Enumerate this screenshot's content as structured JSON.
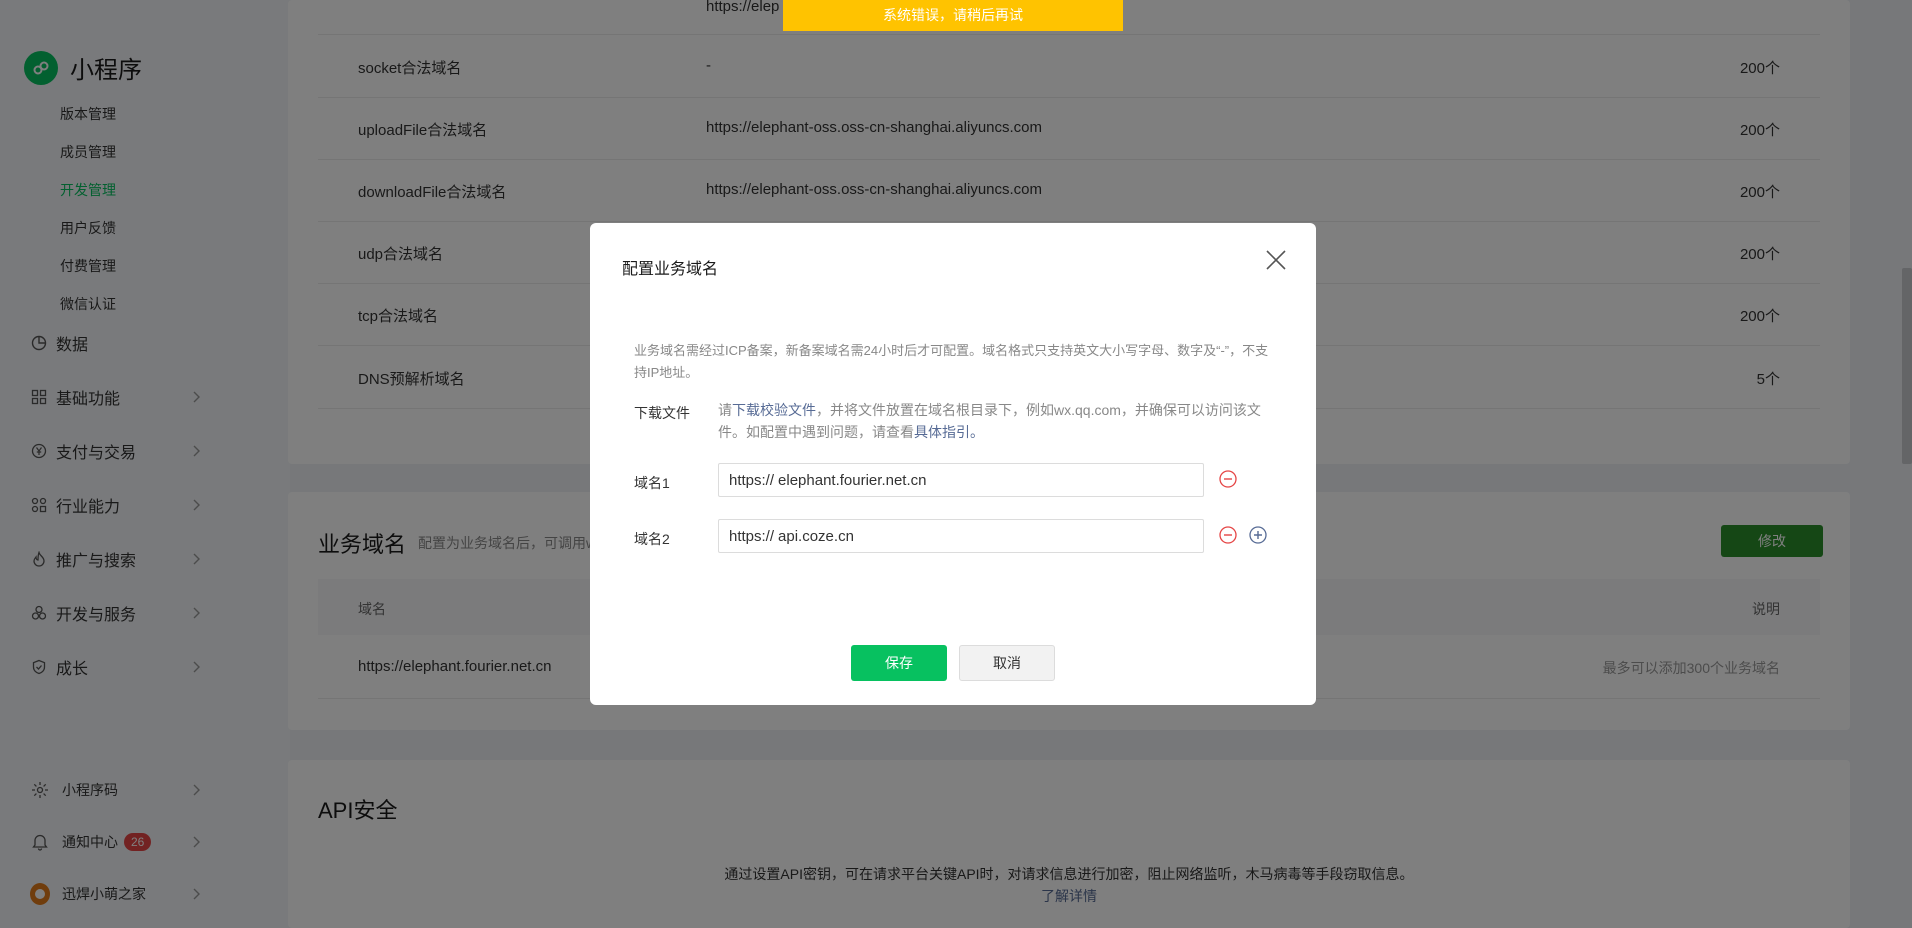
{
  "toast": "系统错误，请稍后再试",
  "sidebar": {
    "brand": "小程序",
    "sub_items": [
      "版本管理",
      "成员管理",
      "开发管理",
      "用户反馈",
      "付费管理",
      "微信认证"
    ],
    "active_sub_item": "开发管理",
    "nav_items": [
      {
        "label": "数据",
        "icon": "pie-chart-icon"
      },
      {
        "label": "基础功能",
        "icon": "grid-icon"
      },
      {
        "label": "支付与交易",
        "icon": "yen-icon"
      },
      {
        "label": "行业能力",
        "icon": "industry-icon"
      },
      {
        "label": "推广与搜索",
        "icon": "flame-icon"
      },
      {
        "label": "开发与服务",
        "icon": "dev-service-icon"
      },
      {
        "label": "成长",
        "icon": "shield-icon"
      }
    ],
    "bottom_items": [
      {
        "label": "小程序码",
        "icon": "qr-code-icon"
      },
      {
        "label": "通知中心",
        "icon": "bell-icon",
        "badge": "26"
      },
      {
        "label": "迅焊小萌之家",
        "icon": "avatar"
      }
    ]
  },
  "server_domains": {
    "top_partial_value": "https://elep",
    "rows": [
      {
        "name": "socket合法域名",
        "value": "-",
        "limit": "200个"
      },
      {
        "name": "uploadFile合法域名",
        "value": "https://elephant-oss.oss-cn-shanghai.aliyuncs.com",
        "limit": "200个"
      },
      {
        "name": "downloadFile合法域名",
        "value": "https://elephant-oss.oss-cn-shanghai.aliyuncs.com",
        "limit": "200个"
      },
      {
        "name": "udp合法域名",
        "value": "",
        "limit": "200个"
      },
      {
        "name": "tcp合法域名",
        "value": "",
        "limit": "200个"
      },
      {
        "name": "DNS预解析域名",
        "value": "",
        "limit": "5个"
      }
    ]
  },
  "business_domain": {
    "title": "业务域名",
    "desc": "配置为业务域名后，可调用w",
    "edit_label": "修改",
    "col_domain": "域名",
    "col_desc": "说明",
    "domain_value": "https://elephant.fourier.net.cn",
    "domain_note": "最多可以添加300个业务域名"
  },
  "api_security": {
    "title": "API安全",
    "desc": "通过设置API密钥，可在请求平台关键API时，对请求信息进行加密，阻止网络监听，木马病毒等手段窃取信息。",
    "link": "了解详情"
  },
  "modal": {
    "title": "配置业务域名",
    "tip": "业务域名需经过ICP备案，新备案域名需24小时后才可配置。域名格式只支持英文大小写字母、数字及“-”，不支持IP地址。",
    "download_label": "下载文件",
    "download_prefix": "请",
    "download_link": "下载校验文件",
    "download_mid": "，并将文件放置在域名根目录下，例如wx.qq.com，并确保可以访问该文件。如配置中遇到问题，请查看",
    "guide_link": "具体指引。",
    "fields": [
      {
        "label": "域名1",
        "prefix": "https://",
        "value": "elephant.fourier.net.cn"
      },
      {
        "label": "域名2",
        "prefix": "https://",
        "value": "api.coze.cn"
      }
    ],
    "save_label": "保存",
    "cancel_label": "取消"
  },
  "colors": {
    "brand_green": "#07c160",
    "edit_button": "#2a8f2a",
    "toast_bg": "#ffc300",
    "badge": "#e54545",
    "remove_red": "#e54545",
    "add_blue": "#576b95",
    "link_blue": "#576b95"
  }
}
